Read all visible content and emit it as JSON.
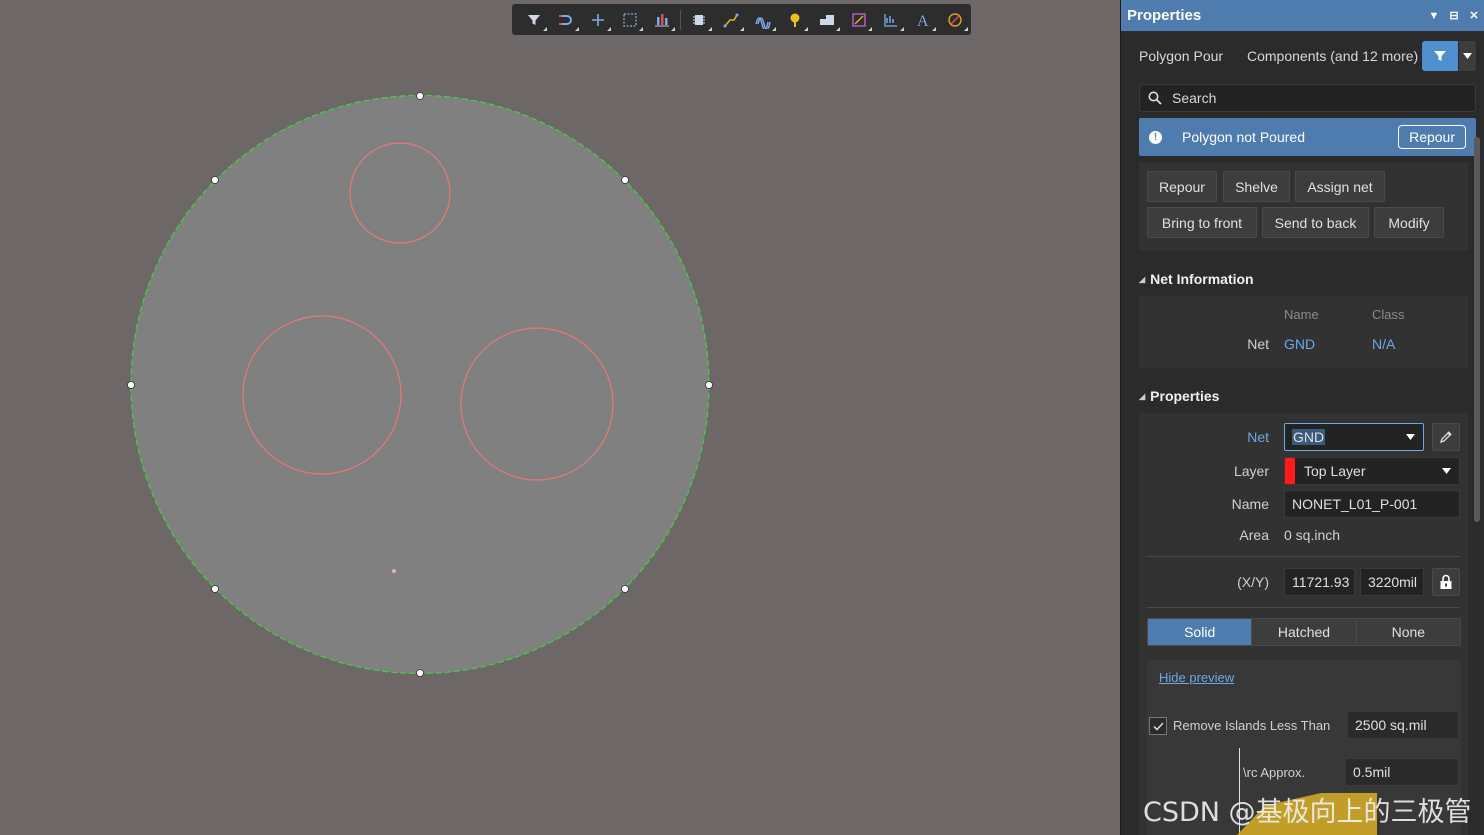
{
  "toolbar": {
    "icons": [
      "filter-icon",
      "snap-icon",
      "cross-icon",
      "select-rect-icon",
      "align-icon",
      "component-icon",
      "route-icon",
      "diff-pair-icon",
      "pad-icon",
      "polygon-icon",
      "region-icon",
      "chart-icon",
      "text-icon",
      "keepout-icon"
    ]
  },
  "board": {
    "outline_color": "#3fd13f",
    "fill_color": "#808080",
    "hole_color": "#e87878"
  },
  "panel": {
    "title": "Properties",
    "object_type": "Polygon Pour",
    "selection": "Components (and 12 more)",
    "search_placeholder": "Search",
    "banner": {
      "message": "Polygon not Poured",
      "button": "Repour"
    },
    "actions": [
      "Repour",
      "Shelve",
      "Assign net",
      "Bring to front",
      "Send to back",
      "Modify"
    ],
    "net_information": {
      "title": "Net Information",
      "col_name": "Name",
      "col_class": "Class",
      "row_label": "Net",
      "name": "GND",
      "class": "N/A"
    },
    "properties": {
      "title": "Properties",
      "net_label": "Net",
      "net_value": "GND",
      "layer_label": "Layer",
      "layer_value": "Top Layer",
      "layer_color": "#ff1a1a",
      "name_label": "Name",
      "name_value": "NONET_L01_P-001",
      "area_label": "Area",
      "area_value": "0 sq.inch",
      "xy_label": "(X/Y)",
      "x_value": "11721.93",
      "y_value": "3220mil",
      "fill_modes": [
        "Solid",
        "Hatched",
        "None"
      ],
      "fill_selected": "Solid",
      "hide_preview": "Hide preview",
      "remove_islands_label": "Remove Islands Less Than",
      "remove_islands_checked": true,
      "remove_islands_value": "2500 sq.mil",
      "arc_label": "\\rc Approx.",
      "arc_value": "0.5mil"
    }
  },
  "watermark": "CSDN @基极向上的三极管"
}
